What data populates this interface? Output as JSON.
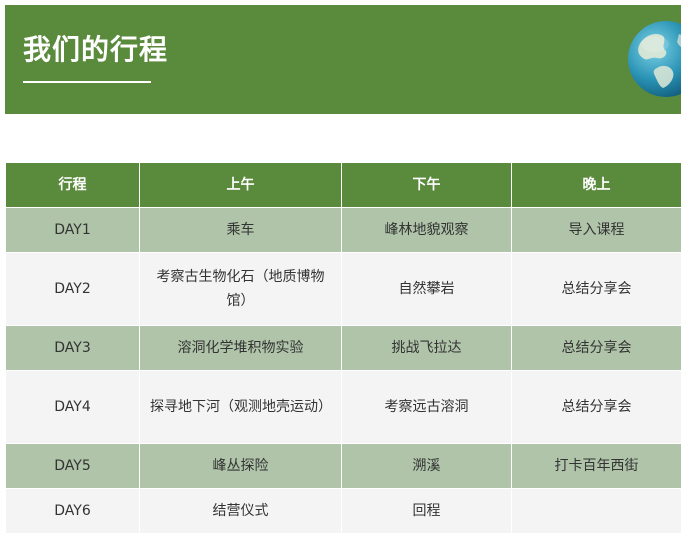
{
  "banner": {
    "title": "我们的行程",
    "bg_color": "#5a8a3c",
    "icon": "globe-icon"
  },
  "table": {
    "header_color": "#5a8a3c",
    "alt_row_color": "#afc4a9",
    "headers": [
      "行程",
      "上午",
      "下午",
      "晚上"
    ],
    "rows": [
      [
        "DAY1",
        "乘车",
        "峰林地貌观察",
        "导入课程"
      ],
      [
        "DAY2",
        "考察古生物化石（地质博物馆）",
        "自然攀岩",
        "总结分享会"
      ],
      [
        "DAY3",
        "溶洞化学堆积物实验",
        "挑战飞拉达",
        "总结分享会"
      ],
      [
        "DAY4",
        "探寻地下河（观测地壳运动）",
        "考察远古溶洞",
        "总结分享会"
      ],
      [
        "DAY5",
        "峰丛探险",
        "溯溪",
        "打卡百年西街"
      ],
      [
        "DAY6",
        "结营仪式",
        "回程",
        ""
      ]
    ]
  }
}
